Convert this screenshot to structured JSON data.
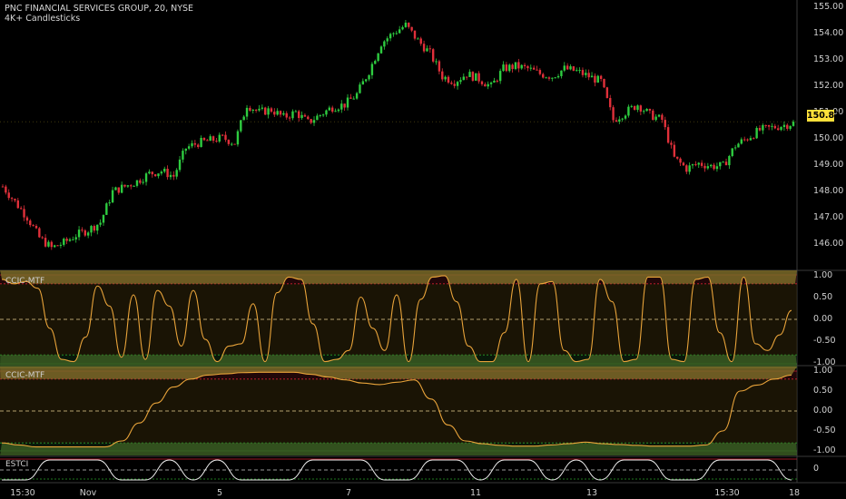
{
  "header": {
    "symbol_line": "PNC FINANCIAL SERVICES GROUP, 20, NYSE",
    "indicator_line": "4K+ Candlesticks"
  },
  "colors": {
    "up": "#2ecc40",
    "down": "#e0303a",
    "osc_line": "#e8a33a",
    "osc_fill_top": "#7a6a28",
    "osc_fill_bottom": "#3a5a22",
    "band_red": "#d02030",
    "band_green": "#2aa02a",
    "grid_dash": "#777777",
    "axis_text": "#cfcfcf",
    "price_tag_bg": "#ffe03a"
  },
  "price_axis": {
    "labels": [
      "155.00",
      "154.00",
      "153.00",
      "152.00",
      "151.00",
      "150.00",
      "149.00",
      "148.00",
      "147.00",
      "146.00"
    ],
    "last_price": "150.83"
  },
  "panels": [
    {
      "name": "CCIC-MTF",
      "labels": [
        "1.00",
        "0.50",
        "0.00",
        "-0.50",
        "-1.00"
      ]
    },
    {
      "name": "CCIC-MTF",
      "labels": [
        "1.00",
        "0.50",
        "0.00",
        "-0.50",
        "-1.00"
      ]
    },
    {
      "name": "ESTCI",
      "labels": [
        "0"
      ]
    }
  ],
  "time_axis": [
    "15:30",
    "Nov",
    "5",
    "7",
    "11",
    "13",
    "15:30",
    "18"
  ],
  "chart_data": [
    {
      "type": "candlestick",
      "title": "PNC FINANCIAL SERVICES GROUP, 20, NYSE",
      "ylim": [
        145.2,
        155.3
      ],
      "close_series": [
        148.3,
        147.7,
        147.1,
        146.3,
        145.9,
        146.1,
        146.4,
        146.6,
        146.9,
        148.1,
        148.3,
        148.5,
        148.8,
        148.9,
        148.7,
        149.8,
        150.0,
        150.1,
        150.2,
        150.0,
        151.5,
        151.2,
        151.3,
        151.0,
        151.2,
        150.8,
        151.1,
        151.4,
        151.5,
        151.9,
        152.8,
        153.9,
        154.3,
        154.6,
        154.0,
        153.5,
        152.6,
        152.4,
        152.7,
        152.5,
        152.2,
        152.9,
        153.0,
        152.9,
        152.7,
        152.6,
        152.9,
        152.8,
        152.6,
        152.4,
        150.9,
        151.2,
        151.5,
        151.1,
        150.9,
        149.4,
        149.0,
        149.2,
        149.1,
        149.1,
        149.9,
        150.2,
        150.5,
        150.6,
        150.7,
        150.8
      ]
    },
    {
      "type": "line",
      "title": "CCIC-MTF",
      "ylim": [
        -1.0,
        1.0
      ],
      "series": [
        {
          "values": [
            0.9,
            0.8,
            0.85,
            0.7,
            -0.2,
            -0.9,
            -0.95,
            -0.4,
            0.75,
            0.3,
            -0.85,
            0.55,
            -0.9,
            0.65,
            0.3,
            -0.6,
            0.65,
            -0.45,
            -0.95,
            -0.6,
            -0.55,
            0.35,
            -0.95,
            0.6,
            0.95,
            0.9,
            -0.1,
            -0.95,
            -0.9,
            -0.7,
            0.5,
            -0.2,
            -0.7,
            0.55,
            -0.95,
            0.45,
            0.95,
            0.98,
            0.4,
            -0.6,
            -0.95,
            -0.95,
            -0.3,
            0.9,
            -0.95,
            0.8,
            0.85,
            -0.7,
            -0.95,
            -0.9,
            0.9,
            0.4,
            -0.95,
            -0.9,
            0.95,
            0.95,
            -0.9,
            -0.95,
            0.9,
            0.95,
            -0.3,
            -0.95,
            0.95,
            -0.55,
            -0.7,
            -0.35,
            0.2
          ]
        }
      ]
    },
    {
      "type": "line",
      "title": "CCIC-MTF",
      "ylim": [
        -1.0,
        1.0
      ],
      "series": [
        {
          "values": [
            -0.8,
            -0.85,
            -0.9,
            -0.9,
            -0.9,
            -0.9,
            -0.9,
            -0.75,
            -0.3,
            0.2,
            0.6,
            0.8,
            0.9,
            0.93,
            0.96,
            0.97,
            0.97,
            0.97,
            0.92,
            0.85,
            0.78,
            0.7,
            0.66,
            0.72,
            0.78,
            0.3,
            -0.35,
            -0.75,
            -0.82,
            -0.86,
            -0.88,
            -0.88,
            -0.85,
            -0.82,
            -0.78,
            -0.82,
            -0.84,
            -0.86,
            -0.88,
            -0.88,
            -0.88,
            -0.85,
            -0.5,
            0.5,
            0.65,
            0.8,
            0.9
          ]
        }
      ]
    },
    {
      "type": "line",
      "title": "ESTCI",
      "series": [
        {
          "values": [
            -1,
            -1,
            1,
            1,
            1,
            -1,
            -1,
            1,
            -1,
            1,
            -1,
            -1,
            -1,
            1,
            1,
            1,
            -1,
            -1,
            1,
            1,
            -1,
            1,
            1,
            -1,
            1,
            -1,
            1,
            1,
            -1,
            -1,
            1,
            1,
            1,
            -1
          ]
        }
      ]
    }
  ]
}
